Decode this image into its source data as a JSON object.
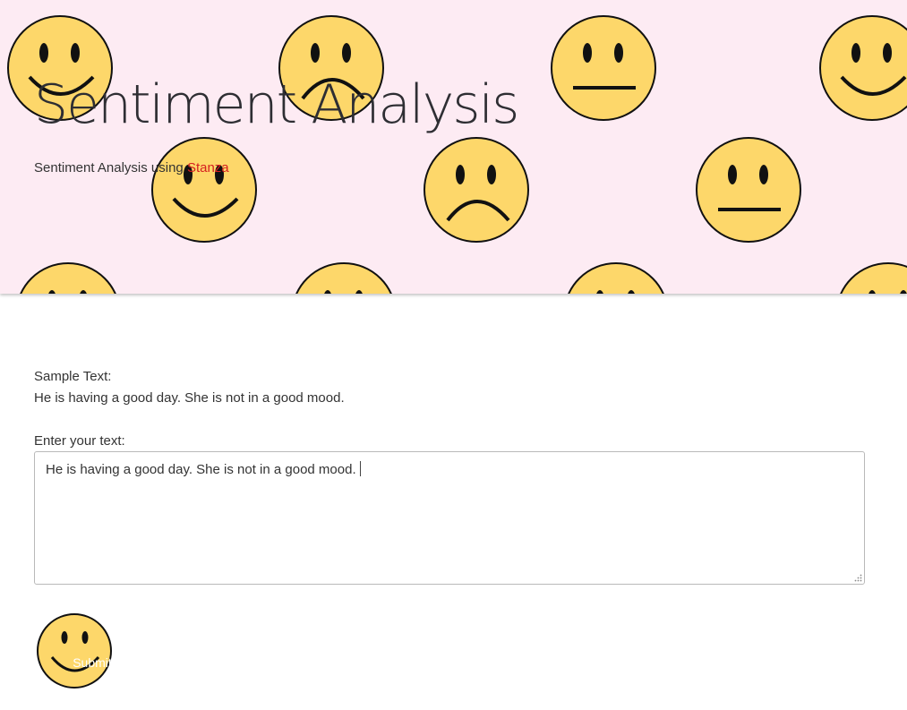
{
  "hero": {
    "title": "Sentiment Analysis",
    "subtitle_prefix": "Sentiment Analysis using ",
    "subtitle_link": "Stanza",
    "background_color": "#fdebf3",
    "face_color": "#fdd76a",
    "link_color": "#d62020"
  },
  "sample": {
    "label": "Sample Text:",
    "text": "He is having a good day. She is not in a good mood."
  },
  "input": {
    "label": "Enter your text:",
    "value": "He is having a good day. She is not in a good mood."
  },
  "submit": {
    "label": "Submit",
    "icon": "happy-face-icon"
  },
  "faces": [
    "happy-face-icon",
    "sad-face-icon",
    "neutral-face-icon"
  ]
}
